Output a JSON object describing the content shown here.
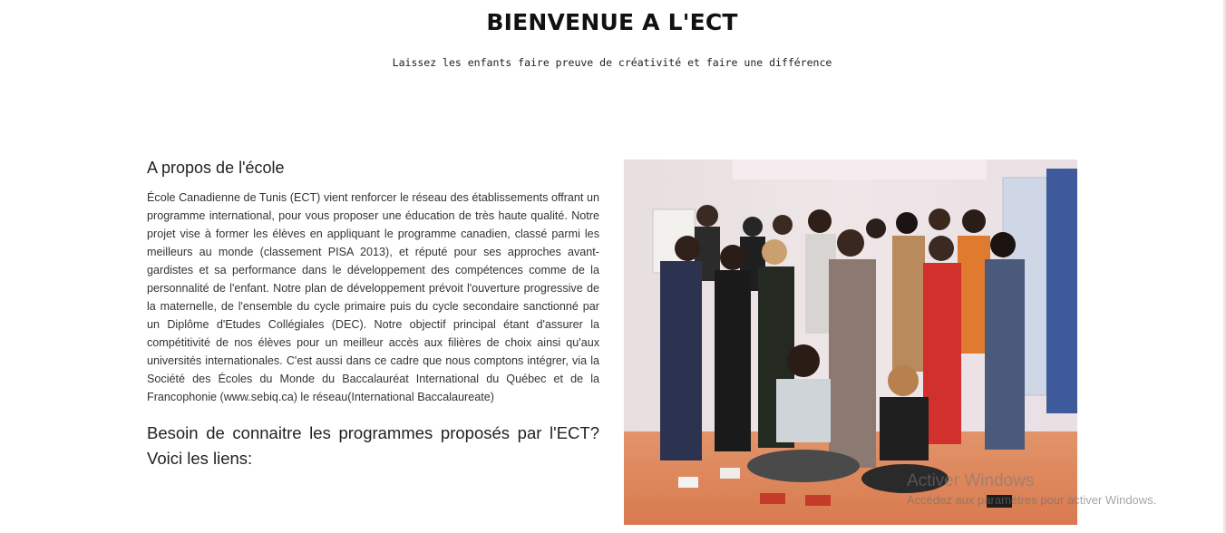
{
  "hero": {
    "title": "BIENVENUE A L'ECT",
    "subtitle": "Laissez les enfants faire preuve de créativité et faire une différence"
  },
  "about": {
    "heading": "A propos de l'école",
    "body": "École Canadienne de Tunis (ECT) vient renforcer le réseau des établissements offrant un programme international, pour vous proposer une éducation de très haute qualité. Notre projet vise à former les élèves en appliquant le programme canadien, classé parmi les meilleurs au monde (classement PISA 2013), et réputé pour ses approches avant-gardistes et sa performance dans le développement des compétences comme de la personnalité de l'enfant. Notre plan de développement prévoit l'ouverture progressive de la maternelle, de l'ensemble du cycle primaire puis du cycle secondaire sanctionné par un Diplôme d'Etudes Collégiales (DEC). Notre objectif principal étant d'assurer la compétitivité de nos élèves pour un meilleur accès aux filières de choix ainsi qu'aux universités internationales. C'est aussi dans ce cadre que nous comptons intégrer, via la Société des Écoles du Monde du Baccalauréat International du Québec et de la Francophonie (www.sebiq.ca) le réseau(International Baccalaureate)",
    "programs_heading": "Besoin de connaitre les programmes proposés par l'ECT? Voici les liens:"
  },
  "photo": {
    "subject": "group-photo-students"
  },
  "windows_activation": {
    "title": "Activer Windows",
    "subtitle": "Accédez aux paramètres pour activer Windows."
  }
}
